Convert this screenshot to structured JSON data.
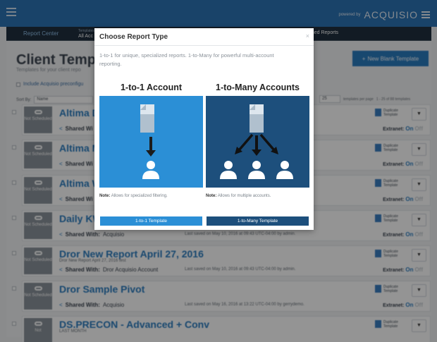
{
  "header": {
    "powered_by": "powered by",
    "logo": "ACQUISIO"
  },
  "nav": {
    "report_center": "Report Center",
    "templates_small": "Templates",
    "templates_label": "All Acc",
    "shared_reports": "hed Reports"
  },
  "page": {
    "title": "Client Template",
    "subtitle": "Templates for your client repo",
    "new_button": "New Blank Template",
    "new_plus": "+",
    "include_label": "Include Acquisio preconfigu",
    "sort_by": "Sort By:",
    "sort_value": "Name",
    "per_page_value": "25",
    "per_page_text": "templates per page",
    "range_text": "1 - 25 of 88 templates"
  },
  "rows": [
    {
      "status": "Not Scheduled",
      "title": "Altima D",
      "subtitle": "",
      "shared_label": "Shared Wi",
      "shared_with": "",
      "saved": "admin.",
      "duplicate": "Duplicate Template",
      "extranet": "Extranet:",
      "on": "On",
      "off": "Off"
    },
    {
      "status": "Not Scheduled",
      "title": "Altima M",
      "subtitle": "",
      "shared_label": "Shared Wi",
      "shared_with": "",
      "saved": "min.",
      "duplicate": "Duplicate Template",
      "extranet": "Extranet:",
      "on": "On",
      "off": "Off"
    },
    {
      "status": "Not Scheduled",
      "title": "Altima W",
      "subtitle": "",
      "shared_label": "Shared Wi",
      "shared_with": "",
      "saved": "min.",
      "duplicate": "Duplicate Template",
      "extranet": "Extranet:",
      "on": "On",
      "off": "Off"
    },
    {
      "status": "Not Scheduled",
      "title": "Daily KW",
      "subtitle": "",
      "shared_label": "Shared With:",
      "shared_with": "Acquisio",
      "saved": "Last saved on May 10, 2016 at 09:43 UTC-04:00 by admin.",
      "duplicate": "Duplicate Template",
      "extranet": "Extranet:",
      "on": "On",
      "off": "Off"
    },
    {
      "status": "Not Scheduled",
      "title": "Dror New Report April 27, 2016",
      "subtitle": "Dror New Report April 27, 2016 test",
      "shared_label": "Shared With:",
      "shared_with": "Dror Acquisio Account",
      "saved": "Last saved on May 10, 2016 at 09:43 UTC-04:00 by admin.",
      "duplicate": "Duplicate Template",
      "extranet": "Extranet:",
      "on": "On",
      "off": "Off"
    },
    {
      "status": "Not Scheduled",
      "title": "Dror Sample Pivot",
      "subtitle": "",
      "shared_label": "Shared With:",
      "shared_with": "Acquisio",
      "saved": "Last saved on May 16, 2016 at 13:22 UTC-04:00 by gerrydemo.",
      "duplicate": "Duplicate Template",
      "extranet": "Extranet:",
      "on": "On",
      "off": "Off"
    },
    {
      "status": "Not",
      "title": "DS.PRECON - Advanced + Conv",
      "subtitle": "LAST MONTH",
      "shared_label": "",
      "shared_with": "",
      "saved": "",
      "duplicate": "Duplicate Template",
      "extranet": "",
      "on": "",
      "off": ""
    }
  ],
  "modal": {
    "title": "Choose Report Type",
    "close": "×",
    "description": "1-to-1 for unique, specialized reports. 1-to-Many for powerful multi-account reporting.",
    "one": {
      "title": "1-to-1 Account",
      "note_label": "Note:",
      "note_text": "Allows for specialized filtering.",
      "button": "1-to-1 Template",
      "color": "#2b8fd6"
    },
    "many": {
      "title": "1-to-Many Accounts",
      "note_label": "Note:",
      "note_text": "Allows for multiple accounts.",
      "button": "1-to-Many Template",
      "color": "#1d4f7c"
    }
  }
}
